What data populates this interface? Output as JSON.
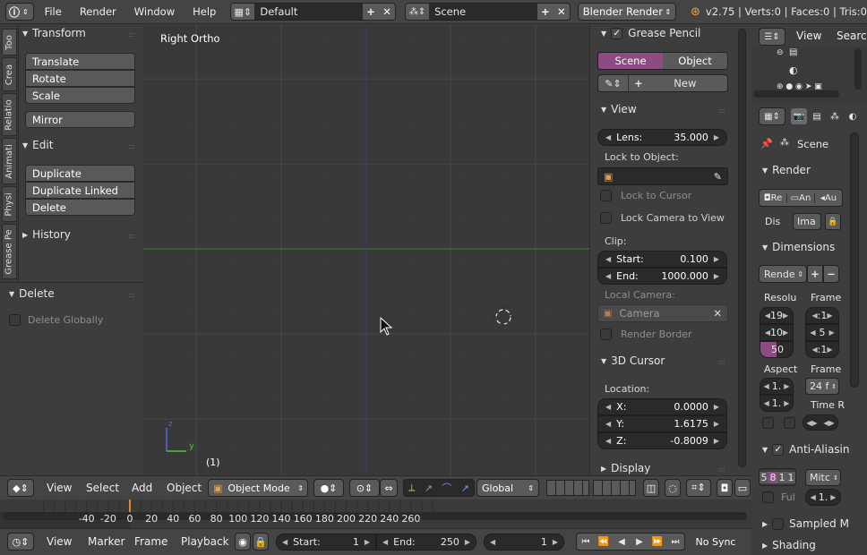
{
  "topbar": {
    "menus": [
      "File",
      "Render",
      "Window",
      "Help"
    ],
    "screen_layout": "Default",
    "scene": "Scene",
    "engine": "Blender Render",
    "stats": "v2.75 | Verts:0 | Faces:0 | Tris:0"
  },
  "toolshelf": {
    "tabs": [
      "Too",
      "Crea",
      "Relatio",
      "Animati",
      "Physi",
      "Grease Pe"
    ],
    "transform_title": "Transform",
    "transform_buttons": [
      "Translate",
      "Rotate",
      "Scale"
    ],
    "mirror": "Mirror",
    "edit_title": "Edit",
    "edit_buttons": [
      "Duplicate",
      "Duplicate Linked",
      "Delete"
    ],
    "history_title": "History"
  },
  "operator": {
    "title": "Delete",
    "delete_globally": "Delete Globally"
  },
  "viewport": {
    "view_name": "Right Ortho",
    "frame_label": "(1)",
    "axis_z": "z",
    "axis_y": "y"
  },
  "npanel": {
    "grease_pencil": "Grease Pencil",
    "scene_tab": "Scene",
    "object_tab": "Object",
    "new_btn": "New",
    "view_title": "View",
    "lens_label": "Lens:",
    "lens_value": "35.000",
    "lock_to_object": "Lock to Object:",
    "lock_to_cursor": "Lock to Cursor",
    "lock_camera": "Lock Camera to View",
    "clip": "Clip:",
    "clip_start_label": "Start:",
    "clip_start": "0.100",
    "clip_end_label": "End:",
    "clip_end": "1000.000",
    "local_camera": "Local Camera:",
    "camera": "Camera",
    "render_border": "Render Border",
    "cursor_title": "3D Cursor",
    "location": "Location:",
    "x_label": "X:",
    "x": "0.0000",
    "y_label": "Y:",
    "y": "1.6175",
    "z_label": "Z:",
    "z": "-0.8009",
    "display_title": "Display"
  },
  "outliner": {
    "view": "View",
    "search": "Search"
  },
  "props": {
    "scene_label": "Scene",
    "render_title": "Render",
    "render_btns": [
      "Re",
      "An",
      "Au"
    ],
    "dis_label": "Dis",
    "dis_value": "Ima",
    "dimensions_title": "Dimensions",
    "preset": "Rende",
    "resolu_label": "Resolu",
    "frame_label": "Frame",
    "res_x": "19",
    "res_y": "10",
    "res_pct": "50",
    "frame_a": ":1",
    "frame_b": "5",
    "frame_c": ":1",
    "aspect_label": "Aspect",
    "frame_rate_label": "Frame",
    "aspect_x": "1.",
    "aspect_y": "1.",
    "fps": "24 f",
    "time_r": "Time R",
    "aa_title": "Anti-Aliasin",
    "aa_samples": [
      "5",
      "8",
      "1",
      "1"
    ],
    "aa_filter": "Mitc",
    "full": "Ful",
    "full_val": "1.",
    "sampled": "Sampled M",
    "shading": "Shading"
  },
  "vpheader": {
    "menus": [
      "View",
      "Select",
      "Add",
      "Object"
    ],
    "mode": "Object Mode",
    "orientation": "Global"
  },
  "timeline": {
    "ticks": [
      "-40",
      "-20",
      "0",
      "20",
      "40",
      "60",
      "80",
      "100",
      "120",
      "140",
      "160",
      "180",
      "200",
      "220",
      "240",
      "260"
    ],
    "current_frame": 1
  },
  "tlheader": {
    "menus": [
      "View",
      "Marker",
      "Frame",
      "Playback"
    ],
    "start_label": "Start:",
    "start": "1",
    "end_label": "End:",
    "end": "250",
    "current": "1",
    "sync": "No Sync"
  }
}
